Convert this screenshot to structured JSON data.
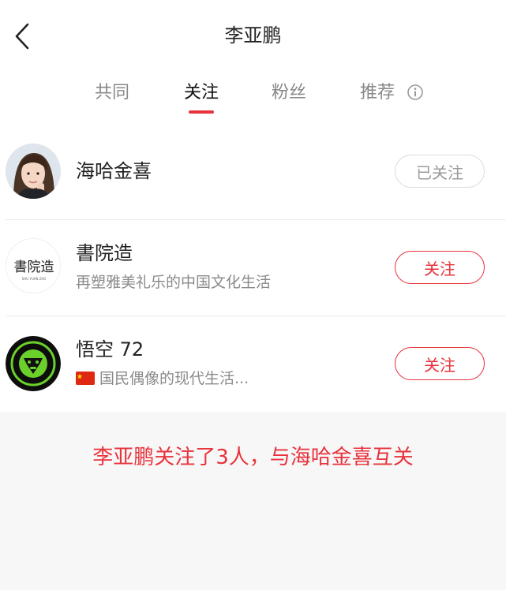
{
  "header": {
    "title": "李亚鹏"
  },
  "tabs": [
    {
      "label": "共同",
      "active": false
    },
    {
      "label": "关注",
      "active": true
    },
    {
      "label": "粉丝",
      "active": false
    },
    {
      "label": "推荐",
      "active": false,
      "icon": "info-icon"
    }
  ],
  "users": [
    {
      "name": "海哈金喜",
      "description": "",
      "button": "已关注",
      "state": "followed"
    },
    {
      "name": "書院造",
      "description": "再塑雅美礼乐的中国文化生活",
      "button": "关注",
      "state": "follow",
      "avatar_text": "書院造",
      "avatar_subtext": "SHU YUAN ZAO"
    },
    {
      "name": "悟空 72",
      "description": "国民偶像的现代生活...",
      "description_icon": "china-flag-icon",
      "button": "关注",
      "state": "follow"
    }
  ],
  "summary": "李亚鹏关注了3人，与海哈金喜互关",
  "colors": {
    "accent": "#e8323c",
    "muted": "#8a8a8a",
    "background": "#f7f7f7"
  }
}
